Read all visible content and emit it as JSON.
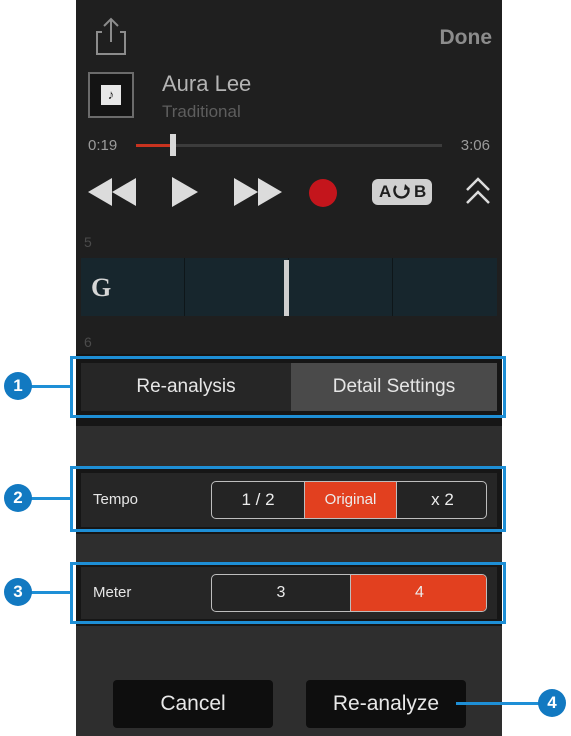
{
  "header": {
    "share_icon": "share-icon",
    "done_label": "Done"
  },
  "song": {
    "art_icon": "music-note-icon",
    "art_glyph": "♪",
    "title": "Aura Lee",
    "artist": "Traditional"
  },
  "playback": {
    "current_time": "0:19",
    "total_time": "3:06",
    "progress_fraction": 0.12
  },
  "controls": {
    "rewind_icon": "rewind-icon",
    "play_icon": "play-icon",
    "fast_forward_icon": "fast-forward-icon",
    "record_icon": "record-icon",
    "ab_repeat_label_a": "A",
    "ab_repeat_label_b": "B",
    "collapse_icon": "double-chevron-up-icon",
    "record_color": "#c4151c"
  },
  "chord_chart": {
    "bar_numbers": [
      "5",
      "6"
    ],
    "first_chord": "G"
  },
  "tabs": {
    "items": [
      "Re-analysis",
      "Detail Settings"
    ],
    "selected_index": 0
  },
  "tempo": {
    "label": "Tempo",
    "options": [
      "1 / 2",
      "Original",
      "x 2"
    ],
    "selected": "Original"
  },
  "meter": {
    "label": "Meter",
    "options": [
      "3",
      "4"
    ],
    "selected": "4"
  },
  "buttons": {
    "cancel_label": "Cancel",
    "reanalyze_label": "Re-analyze"
  },
  "callouts": {
    "numbers": [
      "1",
      "2",
      "3",
      "4"
    ],
    "color": "#1e8fd6"
  }
}
